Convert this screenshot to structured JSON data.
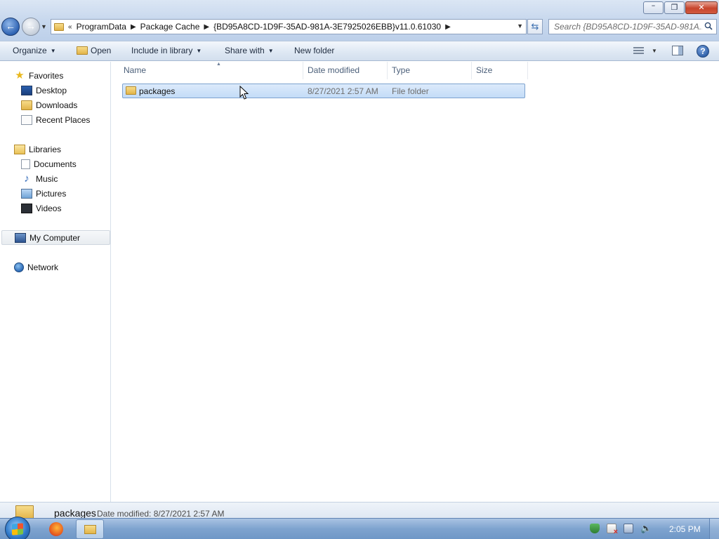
{
  "window": {
    "controls": {
      "minimize": "–",
      "maximize": "❐",
      "close": "✕"
    }
  },
  "address_bar": {
    "overflow": "«",
    "crumbs": [
      "ProgramData",
      "Package Cache",
      "{BD95A8CD-1D9F-35AD-981A-3E7925026EBB}v11.0.61030"
    ]
  },
  "search": {
    "placeholder": "Search {BD95A8CD-1D9F-35AD-981A..."
  },
  "toolbar": {
    "organize": "Organize",
    "open": "Open",
    "include_in_library": "Include in library",
    "share_with": "Share with",
    "new_folder": "New folder"
  },
  "nav_pane": {
    "favorites": "Favorites",
    "desktop": "Desktop",
    "downloads": "Downloads",
    "recent_places": "Recent Places",
    "libraries": "Libraries",
    "documents": "Documents",
    "music": "Music",
    "pictures": "Pictures",
    "videos": "Videos",
    "my_computer": "My Computer",
    "network": "Network"
  },
  "columns": {
    "name": "Name",
    "date_modified": "Date modified",
    "type": "Type",
    "size": "Size"
  },
  "files": [
    {
      "name": "packages",
      "date_modified": "8/27/2021 2:57 AM",
      "type": "File folder",
      "size": ""
    }
  ],
  "details_pane": {
    "name": "packages",
    "meta": "Date modified: 8/27/2021 2:57 AM"
  },
  "taskbar": {
    "clock": "2:05 PM"
  },
  "colors": {
    "selection": "#c3dcf7",
    "selection_border": "#7da2ce",
    "accent": "#2f63b3"
  }
}
